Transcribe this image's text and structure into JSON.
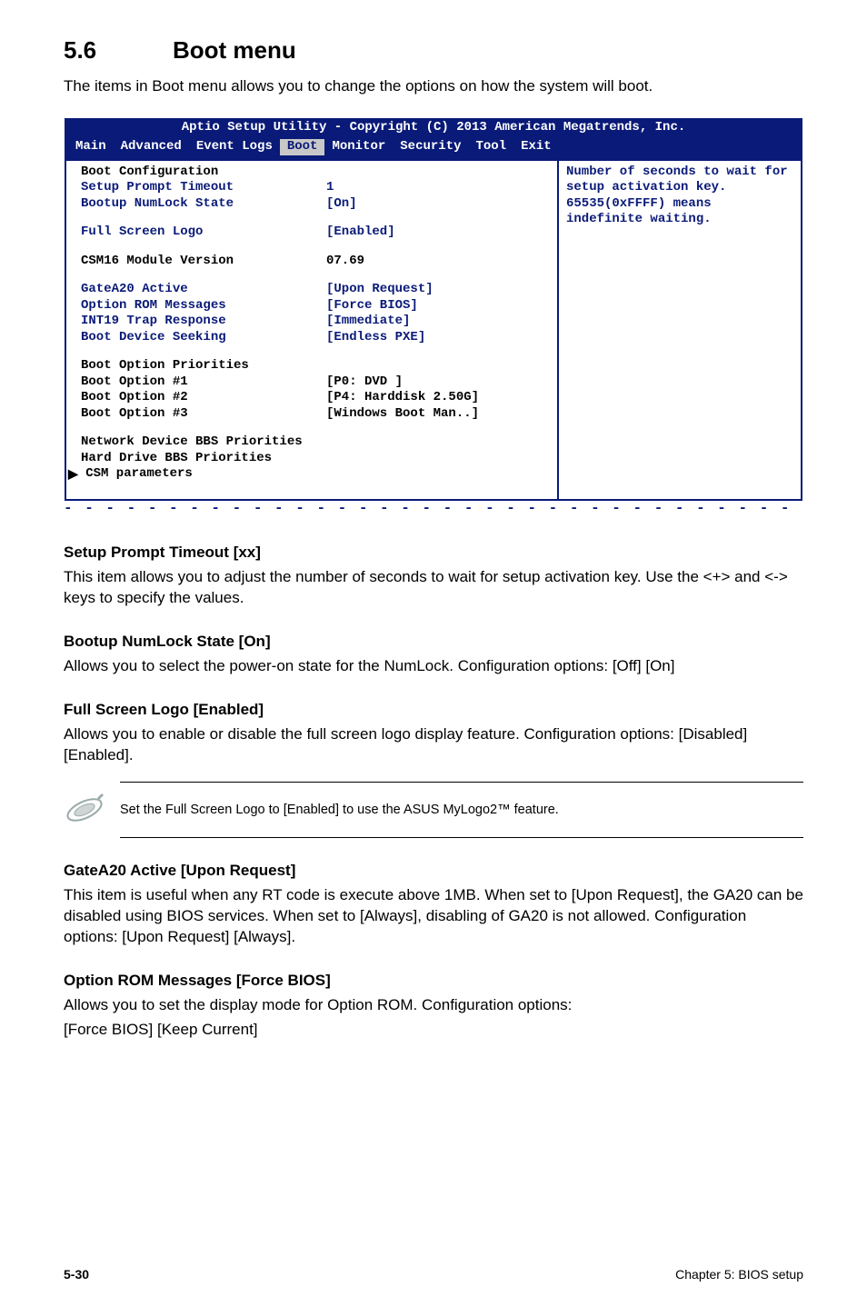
{
  "heading": {
    "num": "5.6",
    "title": "Boot menu"
  },
  "intro": "The items in Boot menu allows you to change the options on how the system will boot.",
  "bios": {
    "titlebar": "Aptio Setup Utility - Copyright (C) 2013 American Megatrends, Inc.",
    "menu": {
      "main": "Main",
      "advanced": "Advanced",
      "eventlogs": "Event Logs",
      "boot": "Boot",
      "monitor": "Monitor",
      "security": "Security",
      "tool": "Tool",
      "exit": "Exit"
    },
    "left": {
      "boot_cfg": "Boot Configuration",
      "setup_prompt_timeout": {
        "label": "Setup Prompt Timeout",
        "value": "1"
      },
      "numlock": {
        "label": "Bootup NumLock State",
        "value": "[On]"
      },
      "full_logo": {
        "label": "Full Screen Logo",
        "value": "[Enabled]"
      },
      "csm16": {
        "label": "CSM16 Module Version",
        "value": "07.69"
      },
      "gatea20": {
        "label": "GateA20 Active",
        "value": "[Upon Request]"
      },
      "optrom": {
        "label": "Option ROM Messages",
        "value": "[Force BIOS]"
      },
      "int19": {
        "label": "INT19 Trap Response",
        "value": "[Immediate]"
      },
      "seeking": {
        "label": "Boot Device Seeking",
        "value": "[Endless PXE]"
      },
      "priorities": "Boot Option Priorities",
      "opt1": {
        "label": "Boot Option #1",
        "value": "[P0: DVD          ]"
      },
      "opt2": {
        "label": "Boot Option #2",
        "value": "[P4: Harddisk 2.50G]"
      },
      "opt3": {
        "label": "Boot Option #3",
        "value": "[Windows Boot Man..]"
      },
      "netdev": "Network Device BBS Priorities",
      "hdd": "Hard Drive BBS Priorities",
      "csm": "CSM parameters",
      "tri": "▶"
    },
    "help": "Number of seconds to wait for setup activation key. 65535(0xFFFF) means indefinite waiting."
  },
  "sections": {
    "spt": {
      "head": "Setup Prompt Timeout [xx]",
      "body": "This item allows you to adjust the number of seconds to wait for setup activation key. Use the <+> and <-> keys to specify the values."
    },
    "numlock": {
      "head": "Bootup NumLock State [On]",
      "body": "Allows you to select the power-on state for the NumLock. Configuration options: [Off] [On]"
    },
    "logo": {
      "head": "Full Screen Logo [Enabled]",
      "body": "Allows you to enable or disable the full screen logo display feature. Configuration options: [Disabled] [Enabled]."
    },
    "note": "Set the Full Screen Logo to [Enabled] to use the ASUS MyLogo2™ feature.",
    "gatea20": {
      "head": "GateA20 Active [Upon Request]",
      "body": "This item is useful when any RT code is execute above 1MB. When set to [Upon Request], the GA20 can be disabled using BIOS services. When set to [Always], disabling of GA20 is not allowed. Configuration options: [Upon Request] [Always]."
    },
    "optrom": {
      "head": "Option ROM Messages [Force BIOS]",
      "body1": "Allows you to set the display mode for Option ROM. Configuration options:",
      "body2": "[Force BIOS] [Keep Current]"
    }
  },
  "footer": {
    "left": "5-30",
    "right": "Chapter 5: BIOS setup"
  }
}
